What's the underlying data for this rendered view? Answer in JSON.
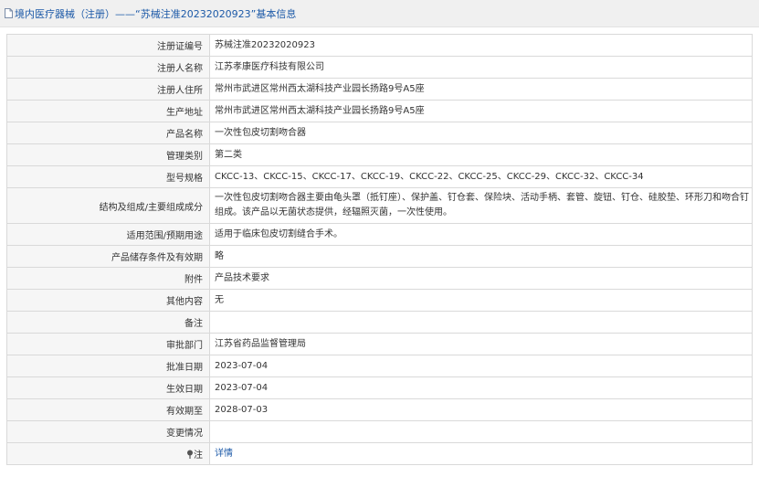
{
  "header": {
    "title": "境内医疗器械（注册）——“苏械注准20232020923”基本信息",
    "icon": "document-icon"
  },
  "colors": {
    "link": "#1d5aa8",
    "label_bg": "#f6f6f6",
    "border": "#d9d9d9"
  },
  "rows": [
    {
      "label": "注册证编号",
      "value": "苏械注准20232020923"
    },
    {
      "label": "注册人名称",
      "value": "江苏孝康医疗科技有限公司"
    },
    {
      "label": "注册人住所",
      "value": "常州市武进区常州西太湖科技产业园长扬路9号A5座"
    },
    {
      "label": "生产地址",
      "value": "常州市武进区常州西太湖科技产业园长扬路9号A5座"
    },
    {
      "label": "产品名称",
      "value": "一次性包皮切割吻合器"
    },
    {
      "label": "管理类别",
      "value": "第二类"
    },
    {
      "label": "型号规格",
      "value": "CKCC-13、CKCC-15、CKCC-17、CKCC-19、CKCC-22、CKCC-25、CKCC-29、CKCC-32、CKCC-34"
    },
    {
      "label": "结构及组成/主要组成成分",
      "value": "一次性包皮切割吻合器主要由龟头罩（抵钉座）、保护盖、钉仓套、保险块、活动手柄、套管、旋钮、钉仓、硅胶垫、环形刀和吻合钉组成。该产品以无菌状态提供，经辐照灭菌，一次性使用。"
    },
    {
      "label": "适用范围/预期用途",
      "value": "适用于临床包皮切割缝合手术。"
    },
    {
      "label": "产品储存条件及有效期",
      "value": "略"
    },
    {
      "label": "附件",
      "value": "产品技术要求"
    },
    {
      "label": "其他内容",
      "value": "无"
    },
    {
      "label": "备注",
      "value": ""
    },
    {
      "label": "审批部门",
      "value": "江苏省药品监督管理局"
    },
    {
      "label": "批准日期",
      "value": "2023-07-04"
    },
    {
      "label": "生效日期",
      "value": "2023-07-04"
    },
    {
      "label": "有效期至",
      "value": "2028-07-03"
    },
    {
      "label": "变更情况",
      "value": ""
    }
  ],
  "note_row": {
    "label": "注",
    "link": "详情",
    "icon": "pin-icon"
  }
}
